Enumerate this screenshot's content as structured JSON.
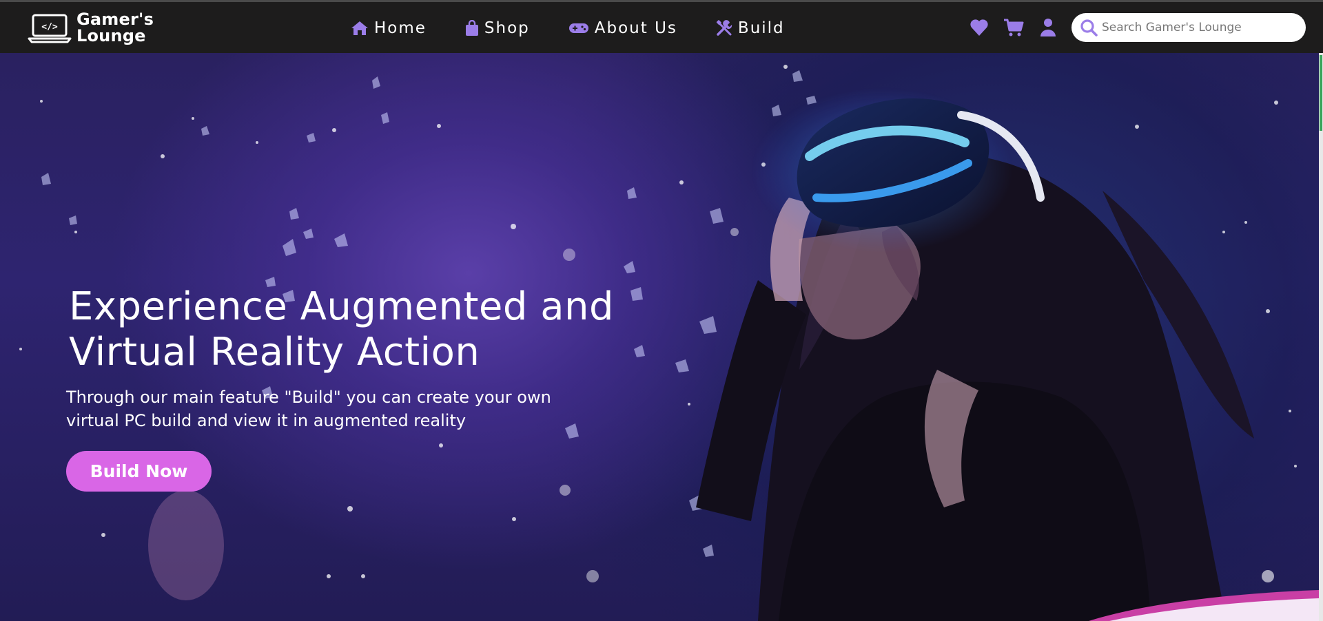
{
  "brand": {
    "name_line1": "Gamer's",
    "name_line2": "Lounge",
    "logo_icon": "laptop-code-icon"
  },
  "nav": {
    "items": [
      {
        "label": "Home",
        "icon": "house-icon"
      },
      {
        "label": "Shop",
        "icon": "shopping-bag-icon"
      },
      {
        "label": "About Us",
        "icon": "gamepad-icon"
      },
      {
        "label": "Build",
        "icon": "tools-icon"
      }
    ],
    "actions": [
      {
        "name": "wishlist",
        "icon": "heart-icon"
      },
      {
        "name": "cart",
        "icon": "cart-icon"
      },
      {
        "name": "account",
        "icon": "user-icon"
      }
    ],
    "search": {
      "placeholder": "Search Gamer's Lounge",
      "value": "",
      "icon": "search-icon"
    }
  },
  "hero": {
    "title_line1": "Experience Augmented and",
    "title_line2": "Virtual Reality Action",
    "subtitle_line1": "Through our main feature \"Build\" you can create your own",
    "subtitle_line2": "virtual PC build and view it in augmented reality",
    "cta_label": "Build Now",
    "image": "woman-wearing-vr-headset-in-space"
  },
  "colors": {
    "navbar_bg": "#1d1c1c",
    "accent_purple": "#9b7de8",
    "cta_pink": "#d966e6",
    "hero_bg": "#2e2470",
    "scroll_thumb": "#3aa55c"
  }
}
